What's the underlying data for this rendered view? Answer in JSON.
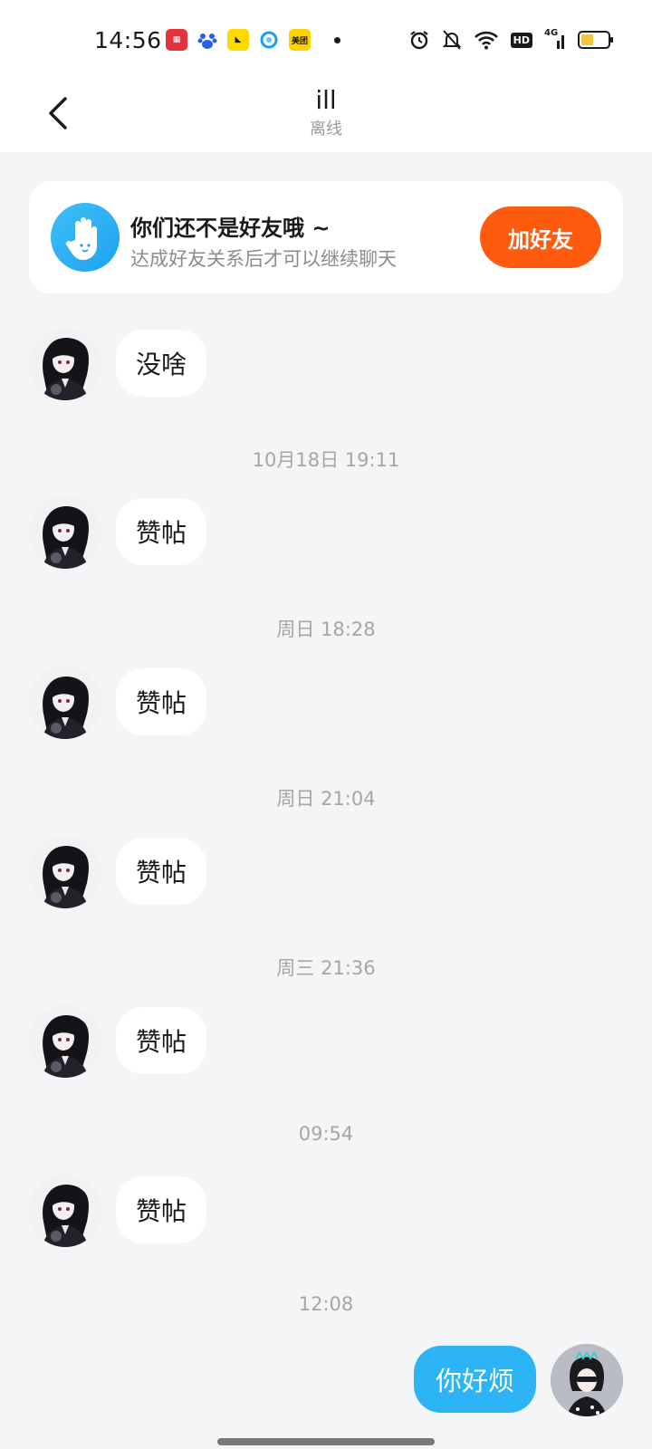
{
  "status_bar": {
    "time": "14:56",
    "apps": [
      "app-icon-1",
      "baidu-icon",
      "app-icon-3",
      "app-icon-4",
      "meituan-icon"
    ],
    "meituan_label": "美团",
    "hd_label": "HD",
    "network_label": "4G",
    "battery_level": 0.45
  },
  "header": {
    "title": "ill",
    "subtitle": "离线"
  },
  "banner": {
    "title": "你们还不是好友哦 ~",
    "subtitle": "达成好友关系后才可以继续聊天",
    "button_label": "加好友"
  },
  "messages": [
    {
      "type": "received",
      "text": "没啥"
    },
    {
      "type": "time",
      "text": "10月18日 19:11"
    },
    {
      "type": "received",
      "text": "赞帖"
    },
    {
      "type": "time",
      "text": "周日 18:28"
    },
    {
      "type": "received",
      "text": "赞帖"
    },
    {
      "type": "time",
      "text": "周日 21:04"
    },
    {
      "type": "received",
      "text": "赞帖"
    },
    {
      "type": "time",
      "text": "周三 21:36"
    },
    {
      "type": "received",
      "text": "赞帖"
    },
    {
      "type": "time",
      "text": "09:54"
    },
    {
      "type": "received",
      "text": "赞帖"
    },
    {
      "type": "time",
      "text": "12:08"
    },
    {
      "type": "sent",
      "text": "你好烦"
    }
  ],
  "colors": {
    "accent_orange": "#ff5b0f",
    "sent_bubble": "#2db4f6",
    "background": "#f4f5f7"
  }
}
